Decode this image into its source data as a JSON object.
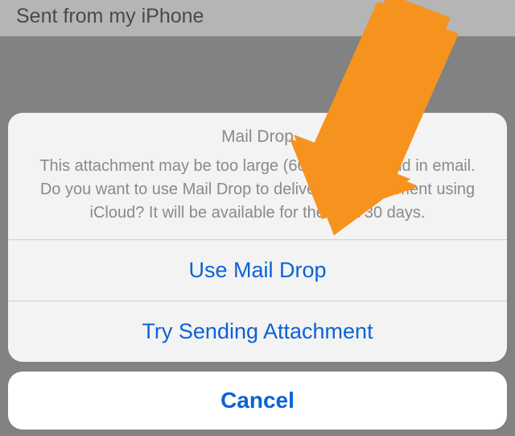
{
  "email": {
    "signature": "Sent from my iPhone"
  },
  "sheet": {
    "title": "Mail Drop",
    "message": "This attachment may be too large (66.6 MB) to send in email. Do you want to use Mail Drop to deliver the attachment using iCloud? It will be available for the next 30 days.",
    "actions": {
      "use_mail_drop": "Use Mail Drop",
      "try_sending": "Try Sending Attachment",
      "cancel": "Cancel"
    }
  },
  "annotation": {
    "arrow_color": "#f6931e"
  }
}
